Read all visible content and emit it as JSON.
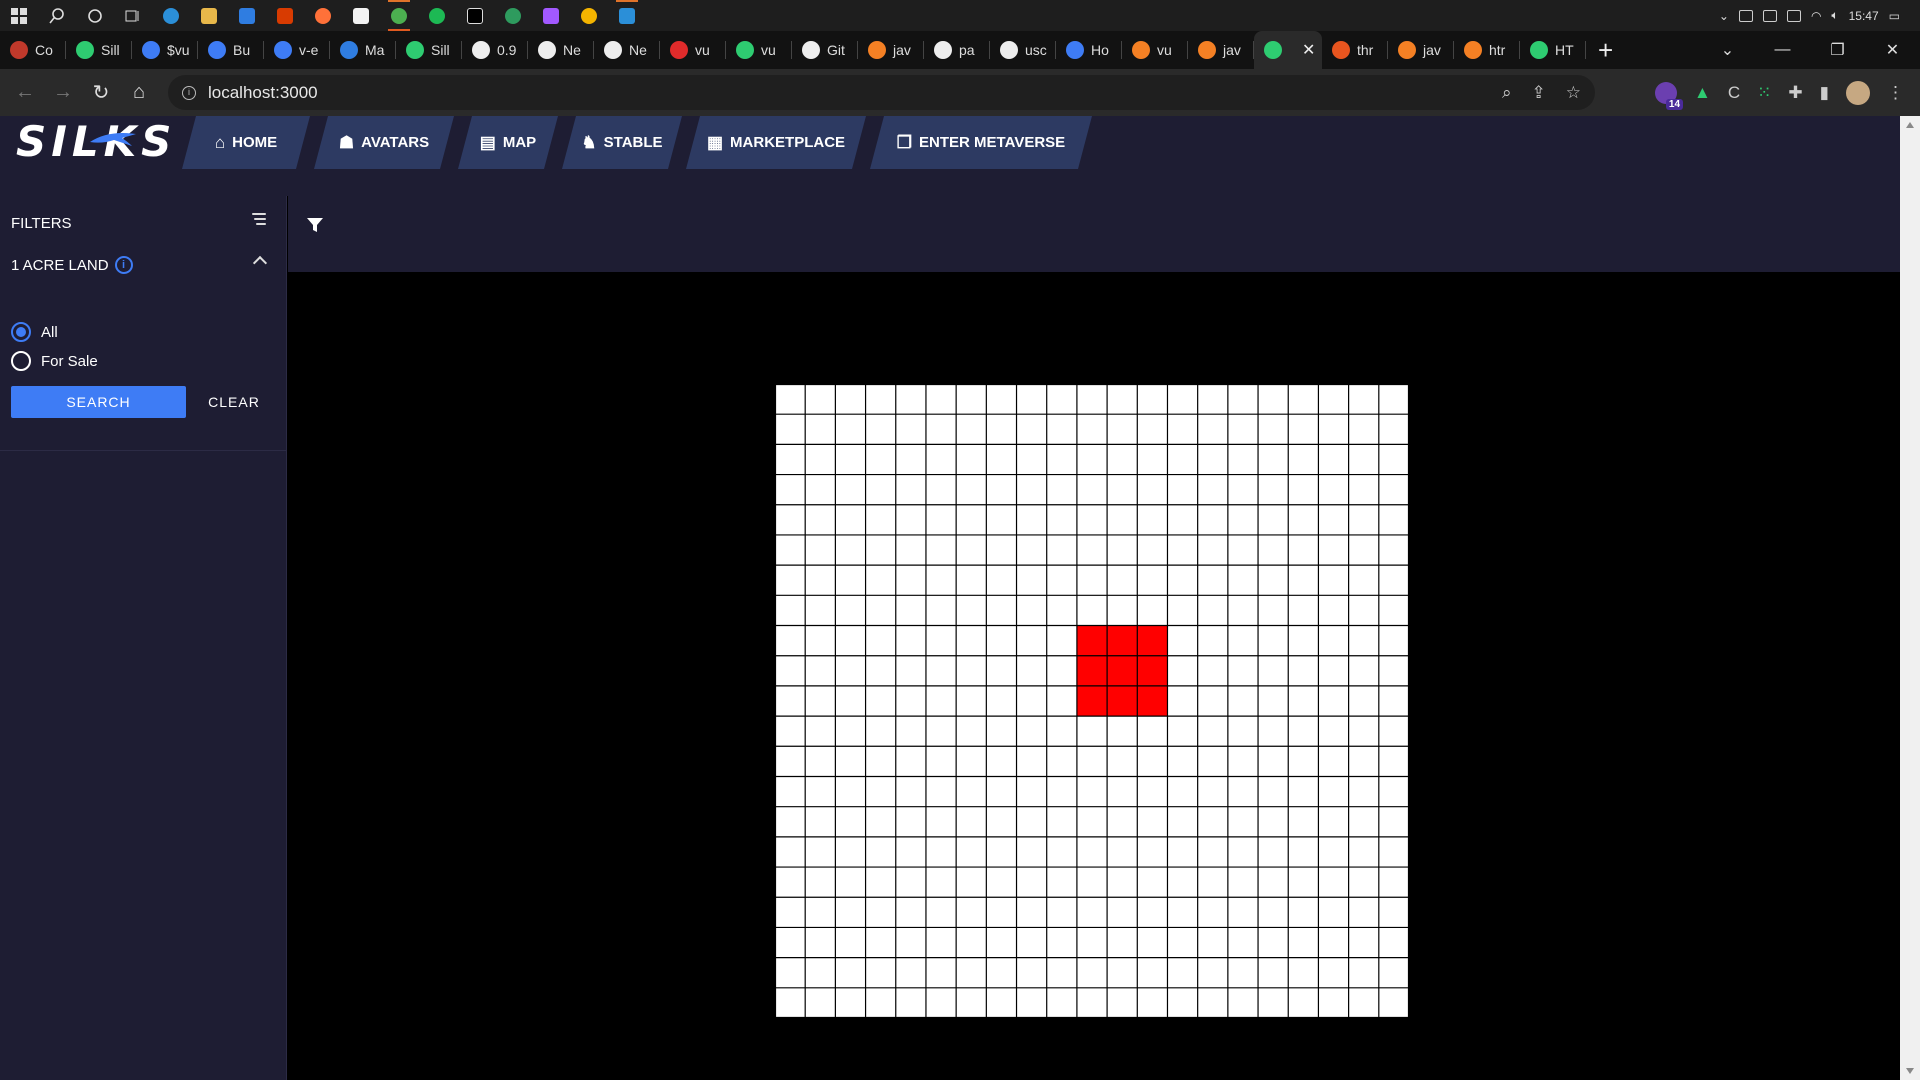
{
  "browser": {
    "tabs": [
      {
        "label": "Co",
        "color": "#c0392b"
      },
      {
        "label": "Sill",
        "color": "#2ecc71"
      },
      {
        "label": "$vu",
        "color": "#3e7cf5"
      },
      {
        "label": "Bu",
        "color": "#3e7cf5"
      },
      {
        "label": "v-e",
        "color": "#3e7cf5"
      },
      {
        "label": "Ma",
        "color": "#2f7de1"
      },
      {
        "label": "Sill",
        "color": "#2ecc71"
      },
      {
        "label": "0.9",
        "color": "#eeeeee"
      },
      {
        "label": "Ne",
        "color": "#eeeeee"
      },
      {
        "label": "Ne",
        "color": "#eeeeee"
      },
      {
        "label": "vu",
        "color": "#e02b2b"
      },
      {
        "label": "vu",
        "color": "#2ecc71"
      },
      {
        "label": "Git",
        "color": "#eeeeee"
      },
      {
        "label": "jav",
        "color": "#f48024"
      },
      {
        "label": "pa",
        "color": "#eeeeee"
      },
      {
        "label": "usc",
        "color": "#eeeeee"
      },
      {
        "label": "Ho",
        "color": "#3e7cf5"
      },
      {
        "label": "vu",
        "color": "#f48024"
      },
      {
        "label": "jav",
        "color": "#f48024"
      },
      {
        "label": "",
        "color": "#2ecc71",
        "active": true
      },
      {
        "label": "thr",
        "color": "#e8551f"
      },
      {
        "label": "jav",
        "color": "#f48024"
      },
      {
        "label": "htr",
        "color": "#f48024"
      },
      {
        "label": "HT",
        "color": "#2ecc71"
      }
    ],
    "url": "localhost:3000",
    "extension_badge": "14",
    "clock": "15:47"
  },
  "app": {
    "logo": "SILKS",
    "nav": [
      {
        "label": "HOME",
        "icon": "home-icon",
        "glyph": "⌂",
        "width": 128
      },
      {
        "label": "AVATARS",
        "icon": "avatars-icon",
        "glyph": "☗",
        "width": 140
      },
      {
        "label": "MAP",
        "icon": "map-icon",
        "glyph": "▤",
        "width": 100
      },
      {
        "label": "STABLE",
        "icon": "stable-icon",
        "glyph": "♞",
        "width": 120
      },
      {
        "label": "MARKETPLACE",
        "icon": "marketplace-icon",
        "glyph": "▦",
        "width": 180
      },
      {
        "label": "ENTER METAVERSE",
        "icon": "metaverse-icon",
        "glyph": "❐",
        "width": 222
      }
    ],
    "filters": {
      "title": "FILTERS",
      "section": "1 ACRE LAND",
      "options": [
        {
          "label": "All",
          "checked": true
        },
        {
          "label": "For Sale",
          "checked": false
        }
      ],
      "search_label": "SEARCH",
      "clear_label": "CLEAR"
    },
    "map": {
      "cells_per_side": 21,
      "highlight": {
        "col": 10,
        "row": 8,
        "span": 3
      },
      "highlight_color": "#ff0000",
      "line_color": "#000000",
      "cell_color": "#ffffff"
    }
  },
  "colors": {
    "accent": "#3e7cf5",
    "nav_bg": "#1e1d33",
    "nav_item_bg": "#2d3a62"
  }
}
